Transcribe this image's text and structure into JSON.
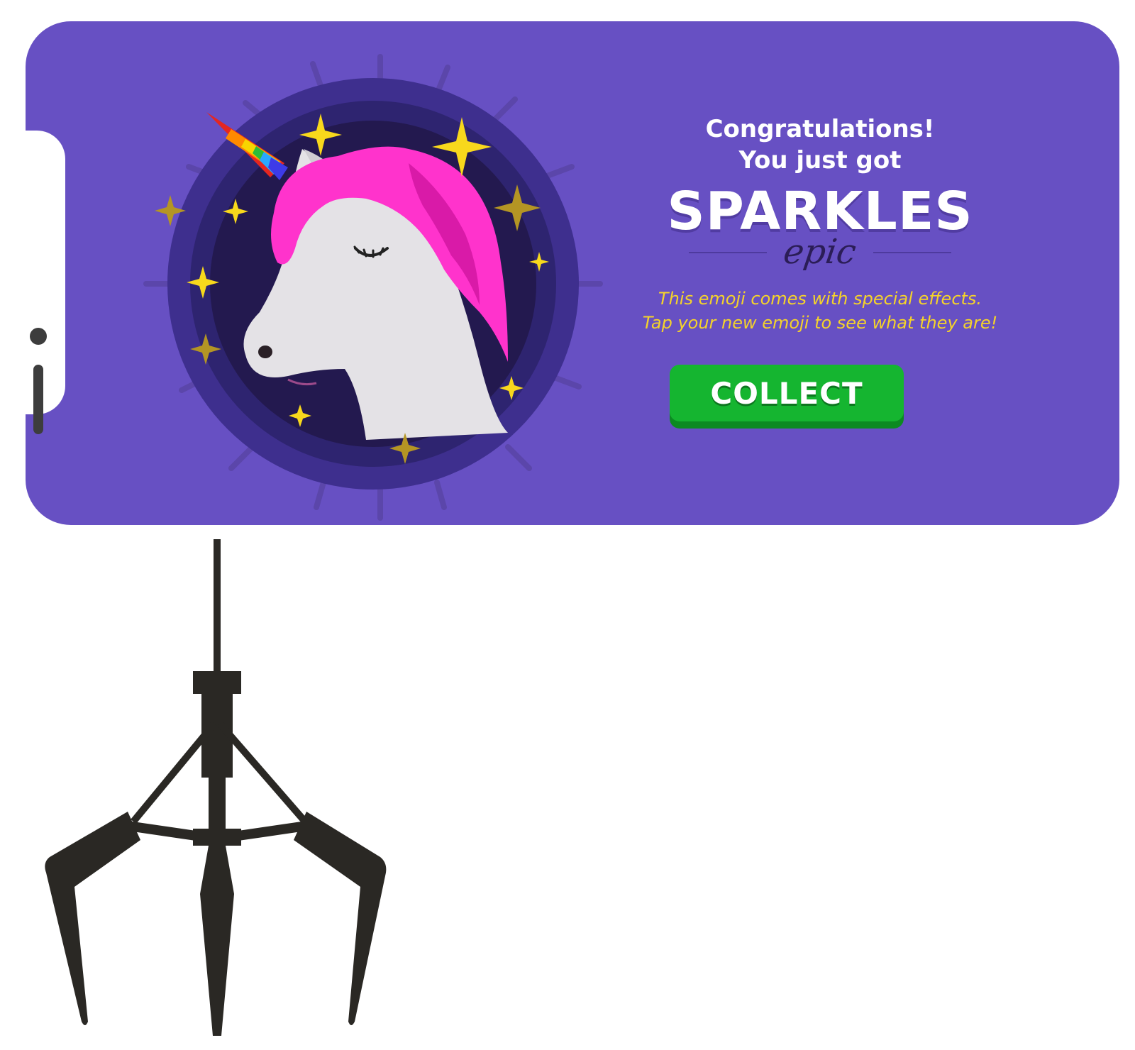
{
  "message": {
    "line1": "Congratulations!",
    "line2": "You just got",
    "title": "SPARKLES",
    "rarity": "epic",
    "effects_line1": "This emoji comes with special effects.",
    "effects_line2": "Tap your new emoji to see what they are!"
  },
  "collect_button": {
    "label": "COLLECT"
  },
  "colors": {
    "background": "#6750c3",
    "effects_text": "#f5d32a",
    "collect_button": "#15b530",
    "rarity_text": "#2b1d57",
    "mane": "#ff33cc",
    "claw": "#2a2824"
  },
  "icons": {
    "badge": "unicorn-emoji-icon",
    "claw": "claw-machine-icon",
    "sparkle": "sparkle-star-icon"
  }
}
